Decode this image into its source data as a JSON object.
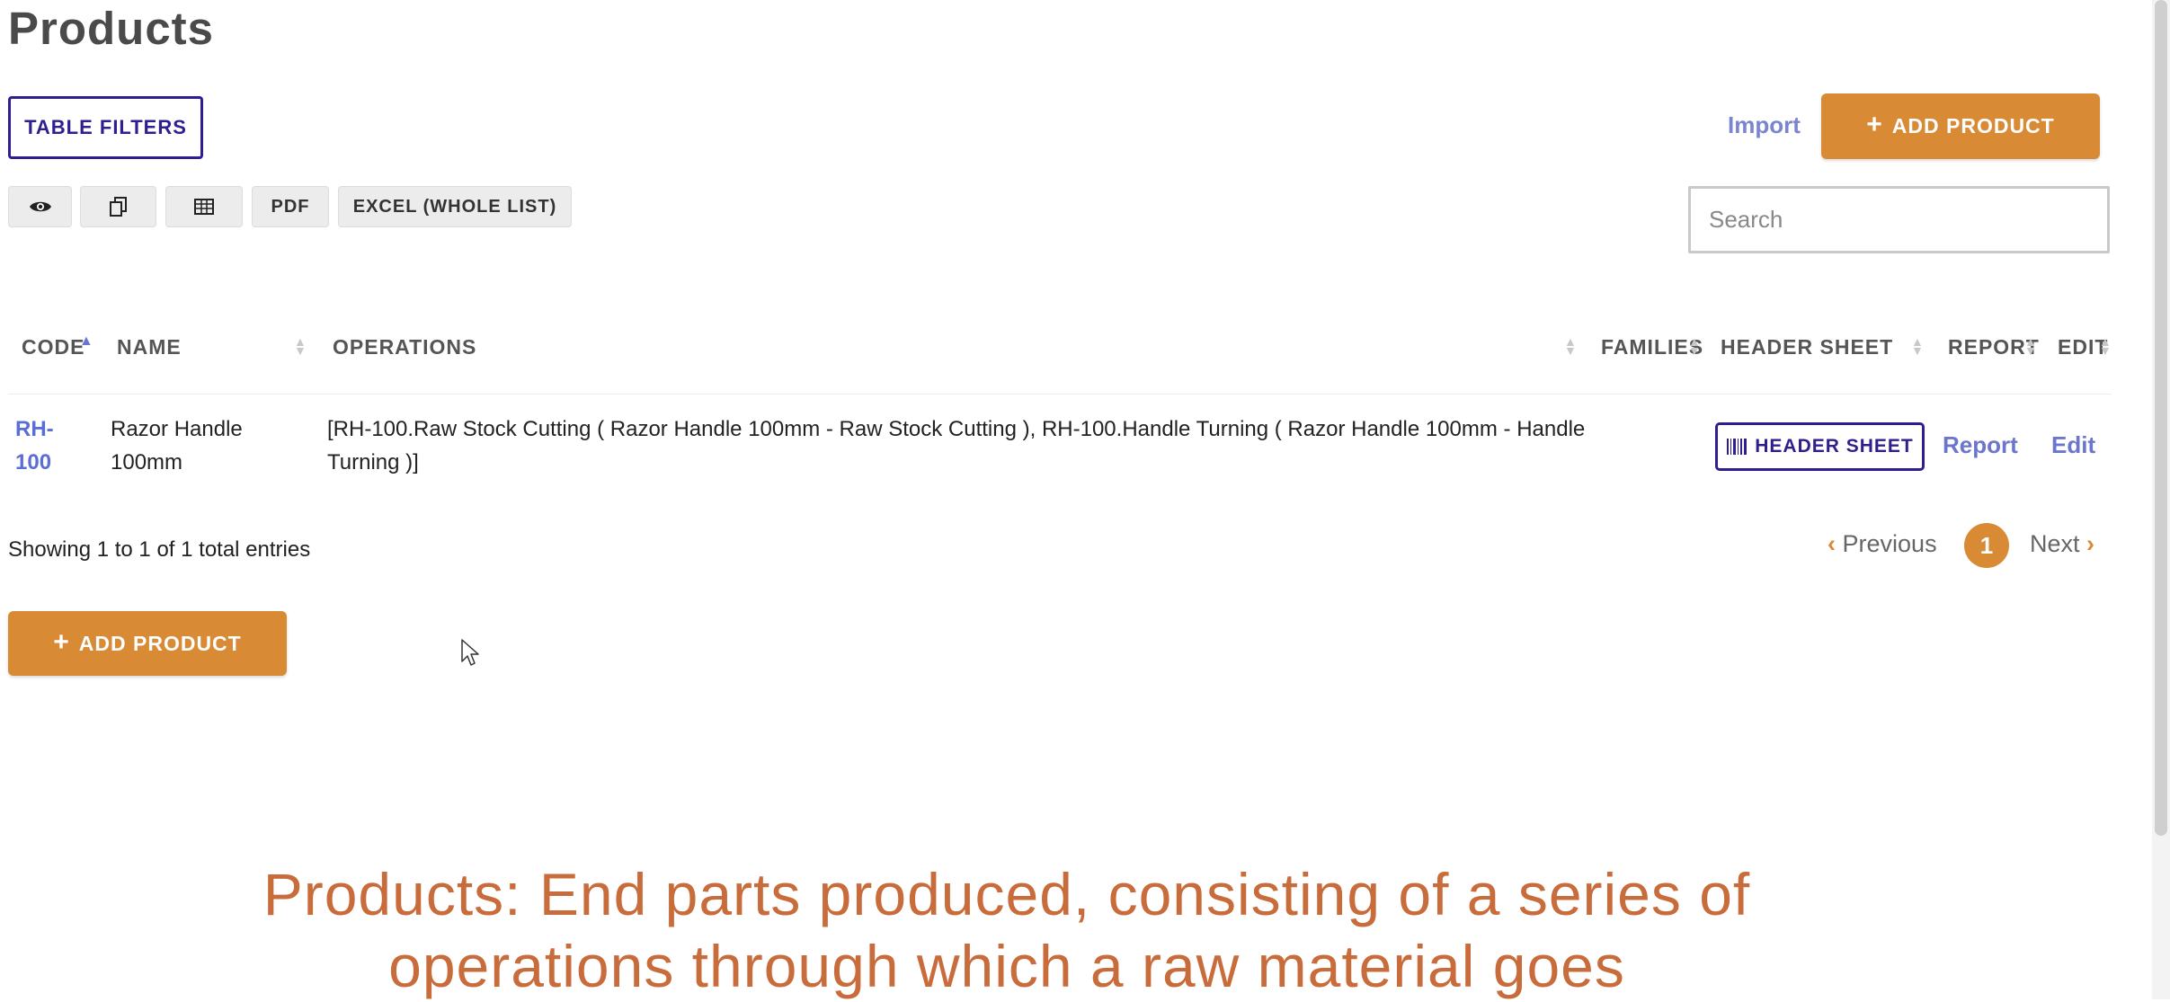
{
  "page": {
    "title": "Products"
  },
  "toolbar": {
    "table_filters_label": "TABLE FILTERS",
    "import_label": "Import",
    "add_product_label": "ADD PRODUCT",
    "buttons": {
      "view_icon": "eye-icon",
      "copy_icon": "copy-icon",
      "csv_icon": "table-icon",
      "pdf_label": "PDF",
      "excel_label": "EXCEL (WHOLE LIST)"
    },
    "search_placeholder": "Search"
  },
  "table": {
    "columns": [
      "CODE",
      "NAME",
      "OPERATIONS",
      "FAMILIES",
      "HEADER SHEET",
      "REPORT",
      "EDIT"
    ],
    "rows": [
      {
        "code_line1": "RH-",
        "code_line2": "100",
        "name_line1": "Razor Handle",
        "name_line2": "100mm",
        "operations_line1": "[RH-100.Raw Stock Cutting ( Razor Handle 100mm - Raw Stock Cutting ), RH-100.Handle Turning ( Razor Handle 100mm - Handle",
        "operations_line2": "Turning )]",
        "families": "",
        "header_sheet_label": "HEADER SHEET",
        "report_label": "Report",
        "edit_label": "Edit"
      }
    ]
  },
  "pagination": {
    "info": "Showing 1 to 1 of 1 total entries",
    "previous_label": "Previous",
    "next_label": "Next",
    "current_page": "1"
  },
  "footer": {
    "add_product_label": "ADD PRODUCT"
  },
  "caption": {
    "line1": "Products: End parts produced, consisting of a series of",
    "line2": "operations through which a raw material goes"
  },
  "colors": {
    "accent_orange": "#d98a35",
    "primary_indigo": "#2d1f8f",
    "link_blue": "#6b76cc",
    "caption": "#c96c3c"
  }
}
